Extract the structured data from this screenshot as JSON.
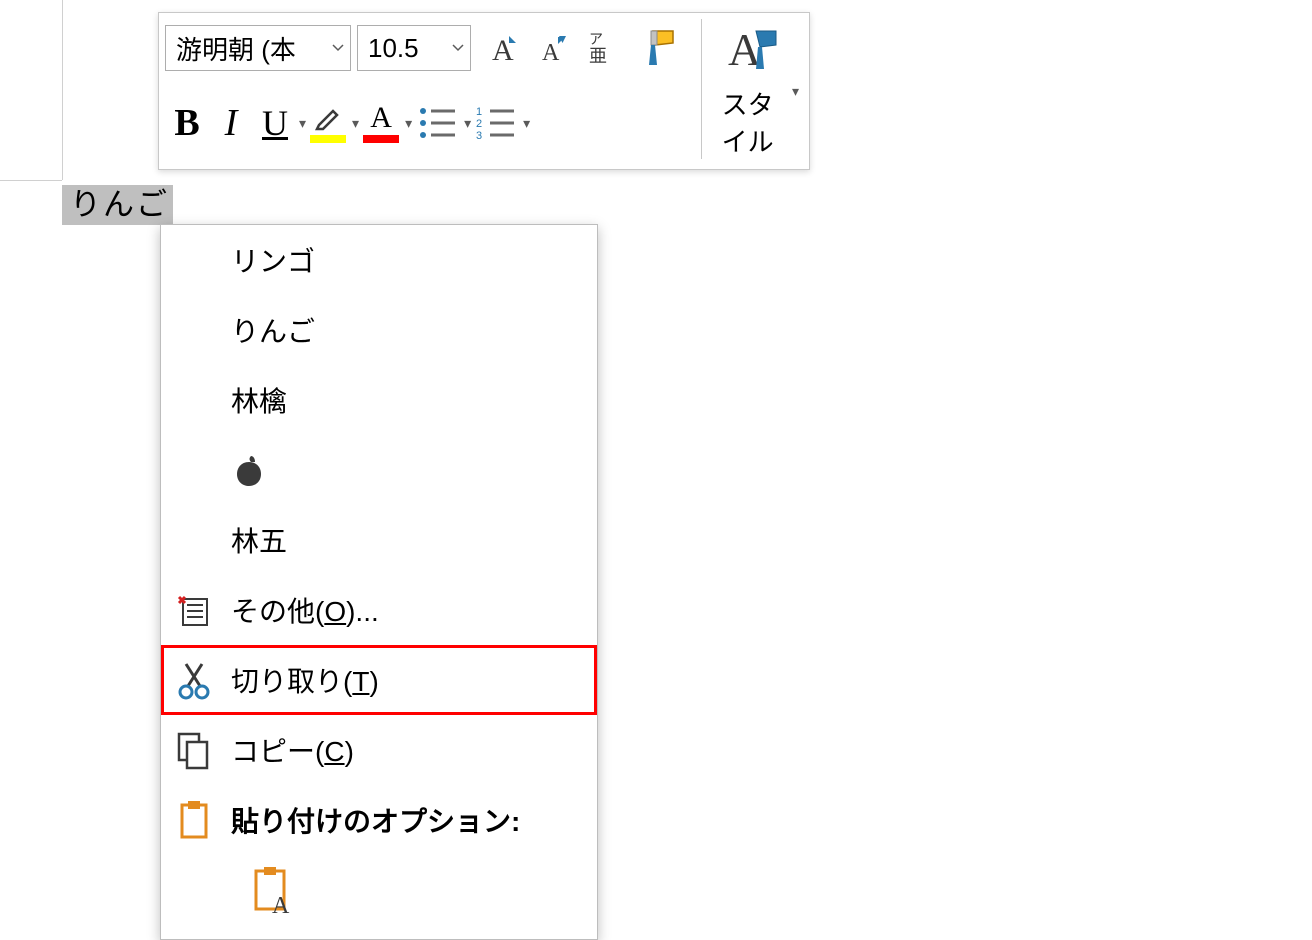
{
  "document": {
    "selected_text": "りんご"
  },
  "mini_toolbar": {
    "font_name": "游明朝 (本",
    "font_size": "10.5",
    "styles_label": "スタイル"
  },
  "context_menu": {
    "ime_candidates": [
      "リンゴ",
      "りんご",
      "林檎",
      "🍎",
      "林五"
    ],
    "other": {
      "label": "その他(",
      "hotkey": "O",
      "suffix": ")..."
    },
    "cut": {
      "label": "切り取り(",
      "hotkey": "T",
      "suffix": ")"
    },
    "copy": {
      "label": "コピー(",
      "hotkey": "C",
      "suffix": ")"
    },
    "paste_hdr": {
      "label": "貼り付けのオプション:"
    }
  },
  "colors": {
    "highlight": "#ffff00",
    "font_color": "#ff0000",
    "select_bg": "#bfbfbf"
  }
}
